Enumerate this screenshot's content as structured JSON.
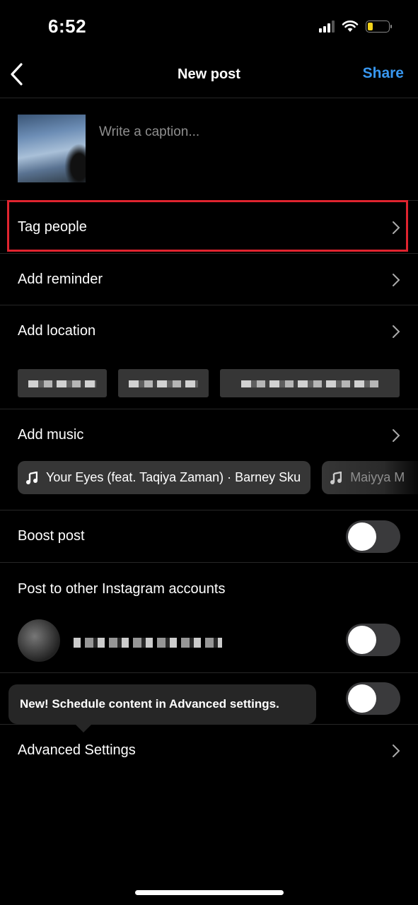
{
  "status_bar": {
    "time": "6:52",
    "icons": [
      "signal-icon",
      "wifi-icon",
      "battery-icon"
    ],
    "battery_level_fraction": 0.2,
    "battery_color": "#f2d21b"
  },
  "header": {
    "back_icon": "chevron-left-icon",
    "title": "New post",
    "share_label": "Share",
    "share_color": "#3897f0"
  },
  "caption": {
    "placeholder": "Write a caption...",
    "value": ""
  },
  "menu": {
    "tag_people": "Tag people",
    "add_reminder": "Add reminder",
    "add_location": "Add location",
    "add_music": "Add music",
    "boost_post": "Boost post",
    "post_to_other_accounts": "Post to other Instagram accounts",
    "advanced_settings": "Advanced Settings"
  },
  "highlight_color": "#e0242f",
  "location_suggestions": [
    "[redacted]",
    "[redacted]",
    "[redacted]"
  ],
  "music_suggestions": [
    {
      "icon": "music-note-icon",
      "label": "Your Eyes (feat. Taqiya Zaman) · Barney Sku"
    },
    {
      "icon": "music-note-icon",
      "label": "Maiyya M"
    }
  ],
  "toggles": {
    "boost_post": false,
    "other_account": false,
    "third_toggle": false
  },
  "other_account": {
    "username": "[redacted]"
  },
  "tooltip": {
    "text": "New! Schedule content in Advanced settings."
  }
}
